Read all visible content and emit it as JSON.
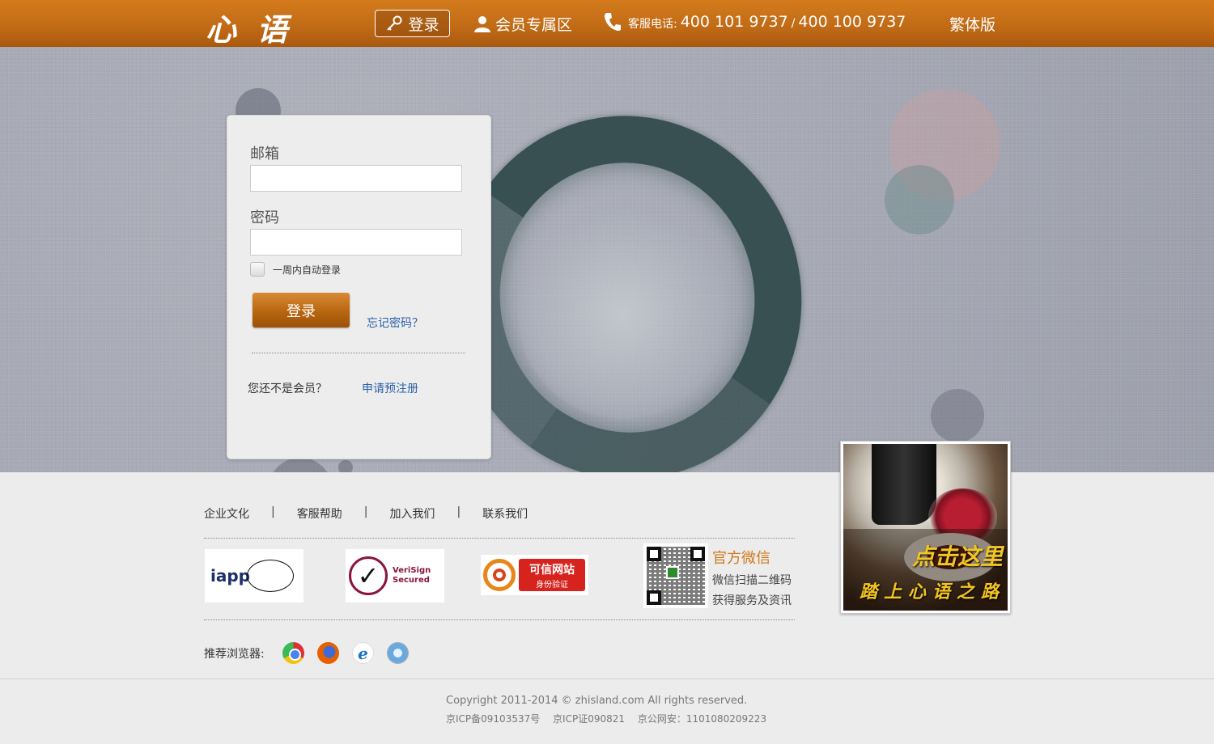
{
  "header": {
    "logo": "心 语",
    "login_label": "登录",
    "member_label": "会员专属区",
    "phone_label": "客服电话:",
    "phone_1": "400 101 9737",
    "phone_sep": "/",
    "phone_2": "400 100 9737",
    "traditional_label": "繁体版",
    "accent_color": "#c06a16"
  },
  "login": {
    "email_label": "邮箱",
    "email_value": "",
    "password_label": "密码",
    "password_value": "",
    "remember_label": "一周内自动登录",
    "remember_checked": false,
    "submit_label": "登录",
    "forgot_label": "忘记密码？",
    "not_member_label": "您还不是会员？",
    "register_label": "申请预注册"
  },
  "footer": {
    "links": [
      "企业文化",
      "客服帮助",
      "加入我们",
      "联系我们"
    ],
    "link_sep": "|",
    "badges": {
      "iapp": "iapp",
      "verisign_1": "VeriSign",
      "verisign_2": "Secured",
      "trusted_1": "可信网站",
      "trusted_2": "身份验证"
    },
    "wechat_title": "官方微信",
    "wechat_line1": "微信扫描二维码",
    "wechat_line2": "获得服务及资讯",
    "browsers_label": "推荐浏览器:",
    "browsers": [
      "chrome-icon",
      "firefox-icon",
      "ie-icon",
      "safari-icon"
    ],
    "copyright": "Copyright 2011-2014 © zhisland.com All rights reserved.",
    "icp": "京ICP备09103537号　 京ICP证090821　 京公网安：1101080209223"
  },
  "promo": {
    "line1": "点击这里",
    "line2": "踏上心语之路"
  }
}
